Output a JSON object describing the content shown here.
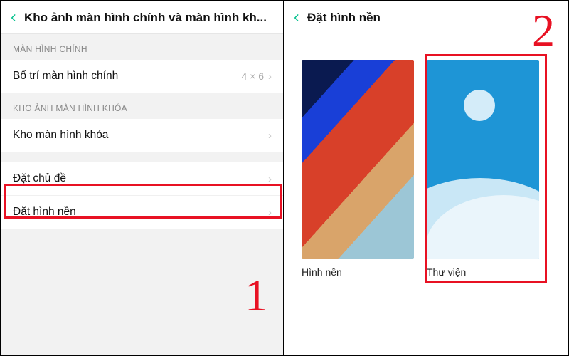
{
  "left": {
    "step_number": "1",
    "title": "Kho ảnh màn hình chính và màn hình kh...",
    "sections": {
      "primary_label": "MÀN HÌNH CHÍNH",
      "lock_label": "KHO ẢNH MÀN HÌNH KHÓA"
    },
    "rows": {
      "layout": {
        "label": "Bố trí màn hình chính",
        "value": "4 × 6"
      },
      "lock_store": {
        "label": "Kho màn hình khóa"
      },
      "theme": {
        "label": "Đặt chủ đề"
      },
      "wallpaper": {
        "label": "Đặt hình nền"
      }
    }
  },
  "right": {
    "step_number": "2",
    "title": "Đặt hình nền",
    "options": {
      "wallpaper": {
        "label": "Hình nền",
        "icon": "default-wallpaper-thumb"
      },
      "gallery": {
        "label": "Thư viện",
        "icon": "gallery-thumb"
      }
    }
  }
}
